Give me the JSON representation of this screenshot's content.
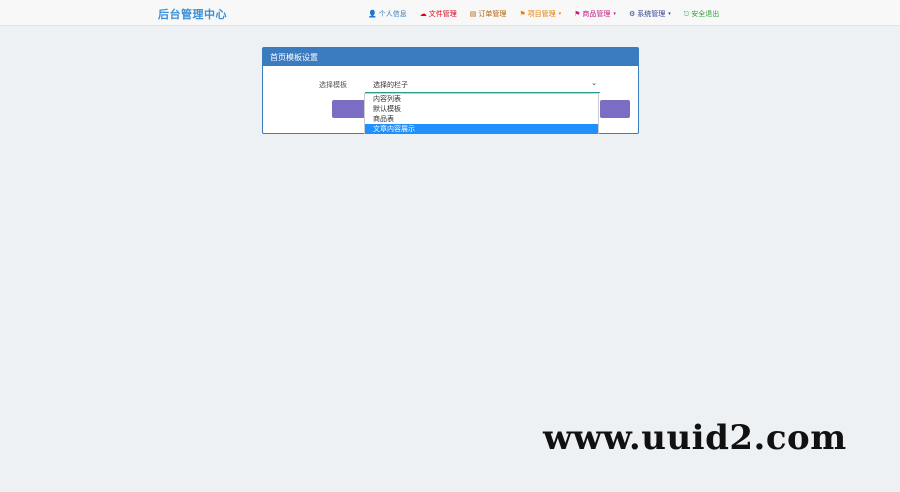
{
  "brand": {
    "title": "后台管理中心"
  },
  "nav": [
    {
      "label": "个人信息",
      "icon": "user-icon",
      "glyph": "👤",
      "color": "#337ab7",
      "caret": ""
    },
    {
      "label": "文件管理",
      "icon": "cloud-icon",
      "glyph": "☁",
      "color": "#d9001b",
      "caret": ""
    },
    {
      "label": "订单管理",
      "icon": "list-icon",
      "glyph": "▤",
      "color": "#b35c00",
      "caret": ""
    },
    {
      "label": "项目管理",
      "icon": "flag-icon",
      "glyph": "⚑",
      "color": "#e67e00",
      "caret": "▾"
    },
    {
      "label": "商品管理",
      "icon": "flag-icon",
      "glyph": "⚑",
      "color": "#c71585",
      "caret": "▾"
    },
    {
      "label": "系统管理",
      "icon": "gear-icon",
      "glyph": "⚙",
      "color": "#2c3e90",
      "caret": "▾"
    },
    {
      "label": "安全退出",
      "icon": "logout-icon",
      "glyph": "⎋",
      "color": "#2e9d3a",
      "caret": ""
    }
  ],
  "panel": {
    "title": "首页模板设置",
    "field_label": "选择模板",
    "select_value": "选择的栏子"
  },
  "dropdown": {
    "options": [
      "内容列表",
      "默认模板",
      "商品表",
      "文章内容展示"
    ],
    "selected_index": 3
  },
  "watermark": "www.uuid2.com"
}
